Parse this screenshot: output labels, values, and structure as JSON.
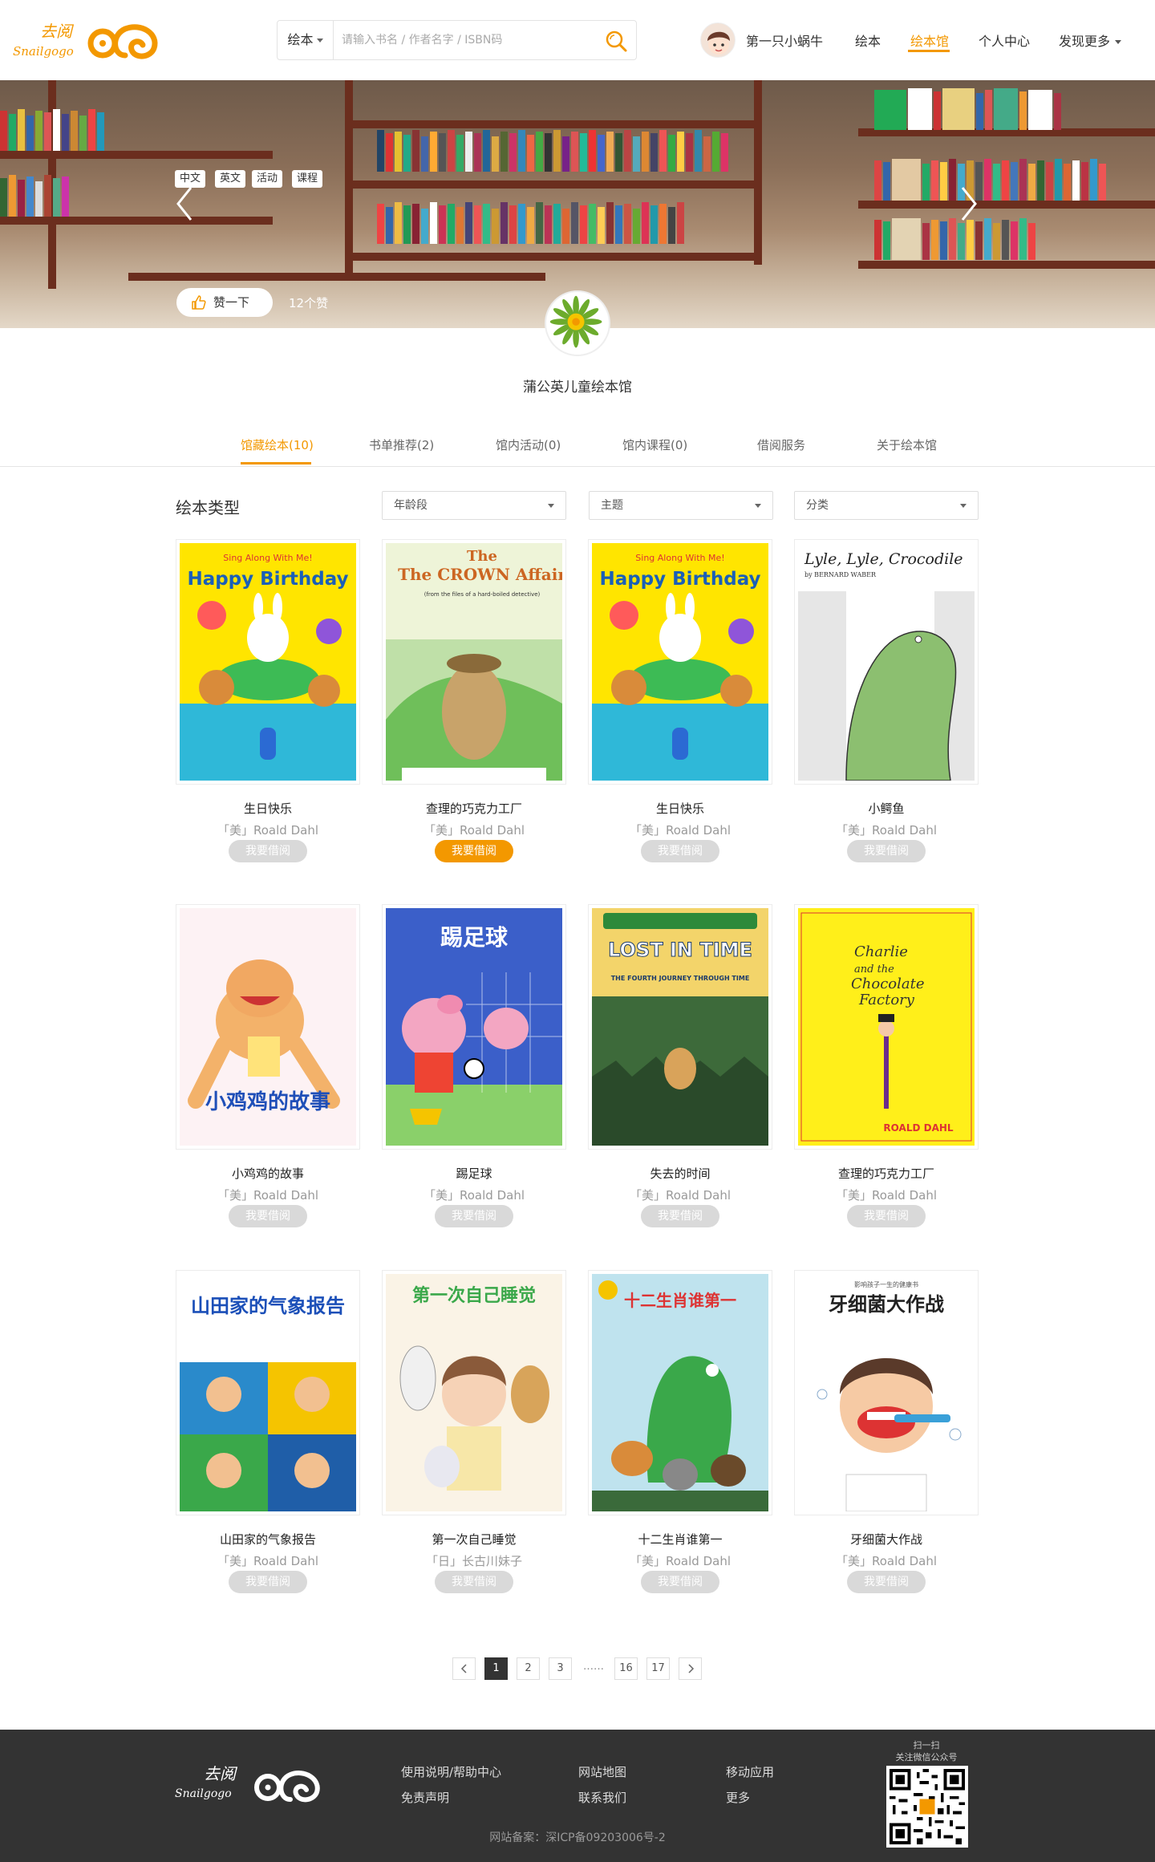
{
  "header": {
    "logo_text": "去阅",
    "logo_sub": "Snailgogo",
    "search": {
      "scope": "绘本",
      "placeholder": "请输入书名 / 作者名字 / ISBN码"
    },
    "user_name": "第一只小蜗牛",
    "nav": [
      "绘本",
      "绘本馆",
      "个人中心",
      "发现更多"
    ],
    "active_nav": "绘本馆"
  },
  "banner": {
    "tags": [
      "中文",
      "英文",
      "活动",
      "课程"
    ],
    "like_label": "赞一下",
    "like_count": "12个赞"
  },
  "library": {
    "name": "蒲公英儿童绘本馆"
  },
  "tabs": [
    "馆藏绘本(10)",
    "书单推荐(2)",
    "馆内活动(0)",
    "馆内课程(0)",
    "借阅服务",
    "关于绘本馆"
  ],
  "filters": {
    "title": "绘本类型",
    "dropdowns": [
      "年龄段",
      "主题",
      "分类"
    ]
  },
  "books": [
    {
      "title": "生日快乐",
      "author": "「美」Roald Dahl",
      "borrow": "我要借阅",
      "available": false,
      "cover_text": "Happy Birthday",
      "cover_sub": "Sing Along With Me!"
    },
    {
      "title": "查理的巧克力工厂",
      "author": "「美」Roald Dahl",
      "borrow": "我要借阅",
      "available": true,
      "cover_text": "The CROWN Affair",
      "cover_sub": "(from the files of a hard-boiled detective)"
    },
    {
      "title": "生日快乐",
      "author": "「美」Roald Dahl",
      "borrow": "我要借阅",
      "available": false,
      "cover_text": "Happy Birthday",
      "cover_sub": "Sing Along With Me!"
    },
    {
      "title": "小鳄鱼",
      "author": "「美」Roald Dahl",
      "borrow": "我要借阅",
      "available": false,
      "cover_text": "Lyle, Lyle, Crocodile",
      "cover_sub": "by BERNARD WABER"
    },
    {
      "title": "小鸡鸡的故事",
      "author": "「美」Roald Dahl",
      "borrow": "我要借阅",
      "available": false,
      "cover_text": "小鸡鸡的故事",
      "cover_sub": ""
    },
    {
      "title": "踢足球",
      "author": "「美」Roald Dahl",
      "borrow": "我要借阅",
      "available": false,
      "cover_text": "踢足球",
      "cover_sub": ""
    },
    {
      "title": "失去的时间",
      "author": "「美」Roald Dahl",
      "borrow": "我要借阅",
      "available": false,
      "cover_text": "LOST IN TIME",
      "cover_sub": "THE FOURTH JOURNEY THROUGH TIME"
    },
    {
      "title": "查理的巧克力工厂",
      "author": "「美」Roald Dahl",
      "borrow": "我要借阅",
      "available": false,
      "cover_text": "Charlie and the Chocolate Factory",
      "cover_sub": "ROALD DAHL"
    },
    {
      "title": "山田家的气象报告",
      "author": "「美」Roald Dahl",
      "borrow": "我要借阅",
      "available": false,
      "cover_text": "山田家的气象报告",
      "cover_sub": ""
    },
    {
      "title": "第一次自己睡觉",
      "author": "「日」长古川妹子",
      "borrow": "我要借阅",
      "available": false,
      "cover_text": "第一次自己睡觉",
      "cover_sub": ""
    },
    {
      "title": "十二生肖谁第一",
      "author": "「美」Roald Dahl",
      "borrow": "我要借阅",
      "available": false,
      "cover_text": "十二生肖谁第一",
      "cover_sub": ""
    },
    {
      "title": "牙细菌大作战",
      "author": "「美」Roald Dahl",
      "borrow": "我要借阅",
      "available": false,
      "cover_text": "牙细菌大作战",
      "cover_sub": "影响孩子一生的健康书"
    }
  ],
  "pagination": {
    "pages": [
      "1",
      "2",
      "3",
      "16",
      "17"
    ],
    "current": "1",
    "ellipsis": "……"
  },
  "footer": {
    "links": [
      "使用说明/帮助中心",
      "免责声明",
      "网站地图",
      "联系我们",
      "移动应用",
      "更多"
    ],
    "qr_caption_1": "扫一扫",
    "qr_caption_2": "关注微信公众号",
    "icp": "网站备案：深ICP备09203006号-2"
  },
  "colors": {
    "accent": "#f39800",
    "footer_bg": "#333333",
    "disabled": "#d9d9d9"
  }
}
